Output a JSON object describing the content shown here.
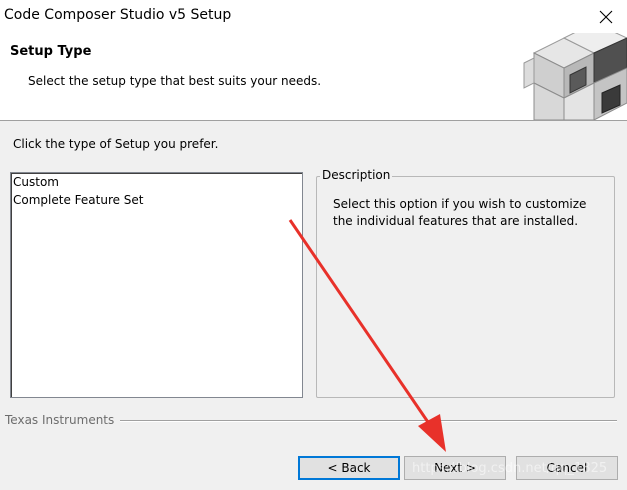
{
  "window": {
    "title": "Code Composer Studio v5 Setup",
    "close_icon": "close-icon"
  },
  "header": {
    "title": "Setup Type",
    "subtitle": "Select the setup type that best suits your needs.",
    "logo_icon": "cubes-logo-icon"
  },
  "main": {
    "prompt": "Click the type of Setup you prefer.",
    "setup_types": [
      {
        "label": "Custom"
      },
      {
        "label": "Complete Feature Set"
      }
    ],
    "description": {
      "legend": "Description",
      "text": "Select this option if you wish to customize the individual features that are installed."
    }
  },
  "footer": {
    "brand": "Texas Instruments",
    "back_label": "< Back",
    "next_label": "Next >",
    "cancel_label": "Cancel",
    "watermark": "https://blog.csdn.net/qq_1825"
  },
  "annotation": {
    "arrow_color": "#e8312a"
  }
}
